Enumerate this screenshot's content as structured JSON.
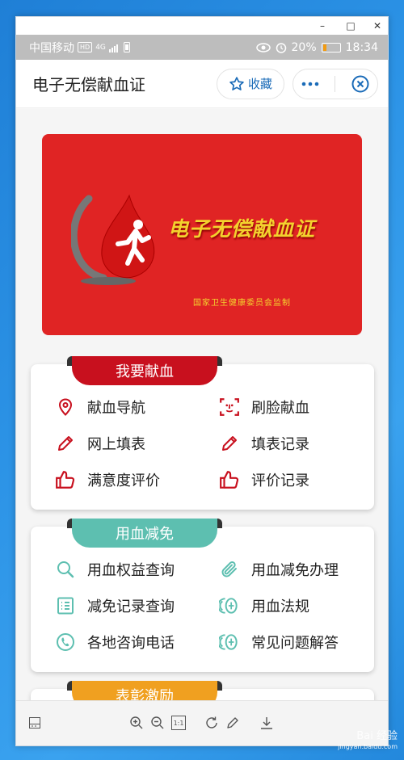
{
  "window": {
    "minimize": "–",
    "maximize": "□",
    "close": "✕"
  },
  "status": {
    "carrier": "中国移动",
    "net_badge": "HD",
    "signal": "4G",
    "battery_pct": "20%",
    "time": "18:34",
    "battery_level": 0.2
  },
  "appbar": {
    "title": "电子无偿献血证",
    "favorite_label": "收藏",
    "more_icon": "more-icon",
    "close_icon": "close-circle-icon"
  },
  "banner": {
    "title": "电子无偿献血证",
    "subtitle": "国家卫生健康委员会监制",
    "bg": "#e02424",
    "text_color": "#f3d22e"
  },
  "sections": [
    {
      "title": "我要献血",
      "color": "#c8101e",
      "items": [
        {
          "label": "献血导航",
          "icon": "location-pin-icon"
        },
        {
          "label": "刷脸献血",
          "icon": "face-scan-icon"
        },
        {
          "label": "网上填表",
          "icon": "pencil-icon"
        },
        {
          "label": "填表记录",
          "icon": "pencil-icon"
        },
        {
          "label": "满意度评价",
          "icon": "thumbs-up-icon"
        },
        {
          "label": "评价记录",
          "icon": "thumbs-up-icon"
        }
      ]
    },
    {
      "title": "用血减免",
      "color": "#5dbfb0",
      "items": [
        {
          "label": "用血权益查询",
          "icon": "search-icon"
        },
        {
          "label": "用血减免办理",
          "icon": "paperclip-icon"
        },
        {
          "label": "减免记录查询",
          "icon": "list-icon"
        },
        {
          "label": "用血法规",
          "icon": "law-icon"
        },
        {
          "label": "各地咨询电话",
          "icon": "phone-icon"
        },
        {
          "label": "常见问题解答",
          "icon": "law-icon"
        }
      ]
    },
    {
      "title": "表彰激励",
      "color": "#f0a020",
      "items": []
    }
  ],
  "toolbar": {
    "actual_size_label": "1:1"
  },
  "watermark": {
    "brand": "Bai 经验",
    "url": "jingyan.baidu.com"
  }
}
